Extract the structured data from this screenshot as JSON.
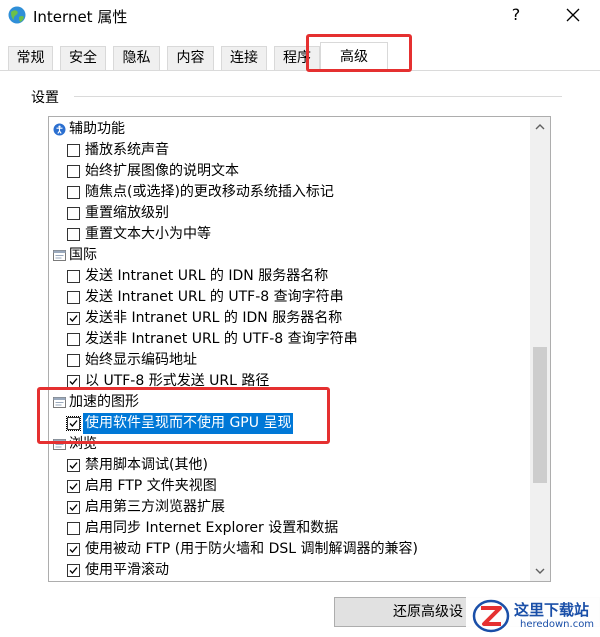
{
  "window": {
    "title": "Internet 属性",
    "help_label": "?",
    "close_icon": "close-icon"
  },
  "tabs": [
    {
      "label": "常规"
    },
    {
      "label": "安全"
    },
    {
      "label": "隐私"
    },
    {
      "label": "内容"
    },
    {
      "label": "连接"
    },
    {
      "label": "程序"
    },
    {
      "label": "高级",
      "active": true
    }
  ],
  "settings": {
    "group_label": "设置",
    "categories": [
      {
        "label": "辅助功能",
        "icon": "accessibility-icon",
        "items": [
          {
            "label": "播放系统声音",
            "checked": false
          },
          {
            "label": "始终扩展图像的说明文本",
            "checked": false
          },
          {
            "label": "随焦点(或选择)的更改移动系统插入标记",
            "checked": false
          },
          {
            "label": "重置缩放级别",
            "checked": false
          },
          {
            "label": "重置文本大小为中等",
            "checked": false
          }
        ]
      },
      {
        "label": "国际",
        "icon": "settings-category-icon",
        "items": [
          {
            "label": "发送 Intranet URL 的 IDN 服务器名称",
            "checked": false
          },
          {
            "label": "发送 Intranet URL 的 UTF-8 查询字符串",
            "checked": false
          },
          {
            "label": "发送非 Intranet URL 的 IDN 服务器名称",
            "checked": true
          },
          {
            "label": "发送非 Intranet URL 的 UTF-8 查询字符串",
            "checked": false
          },
          {
            "label": "始终显示编码地址",
            "checked": false
          },
          {
            "label": "以 UTF-8 形式发送 URL 路径",
            "checked": true
          }
        ]
      },
      {
        "label": "加速的图形",
        "icon": "settings-category-icon",
        "items": [
          {
            "label": "使用软件呈现而不使用 GPU 呈现",
            "checked": true,
            "selected": true
          }
        ]
      },
      {
        "label": "浏览",
        "icon": "settings-category-icon",
        "items": [
          {
            "label": "禁用脚本调试(其他)",
            "checked": true
          },
          {
            "label": "启用 FTP 文件夹视图",
            "checked": true
          },
          {
            "label": "启用第三方浏览器扩展",
            "checked": true
          },
          {
            "label": "启用同步 Internet Explorer 设置和数据",
            "checked": false
          },
          {
            "label": "使用被动 FTP (用于防火墙和 DSL 调制解调器的兼容)",
            "checked": true
          },
          {
            "label": "使用平滑滚动",
            "checked": true
          }
        ]
      }
    ]
  },
  "buttons": {
    "restore_advanced": "还原高级设"
  },
  "watermark": {
    "title": "这里下载站",
    "subtitle": "heredown.com"
  },
  "colors": {
    "highlight_box": "#e53030",
    "selection": "#0078d7",
    "watermark_text": "#1a4fa8"
  }
}
